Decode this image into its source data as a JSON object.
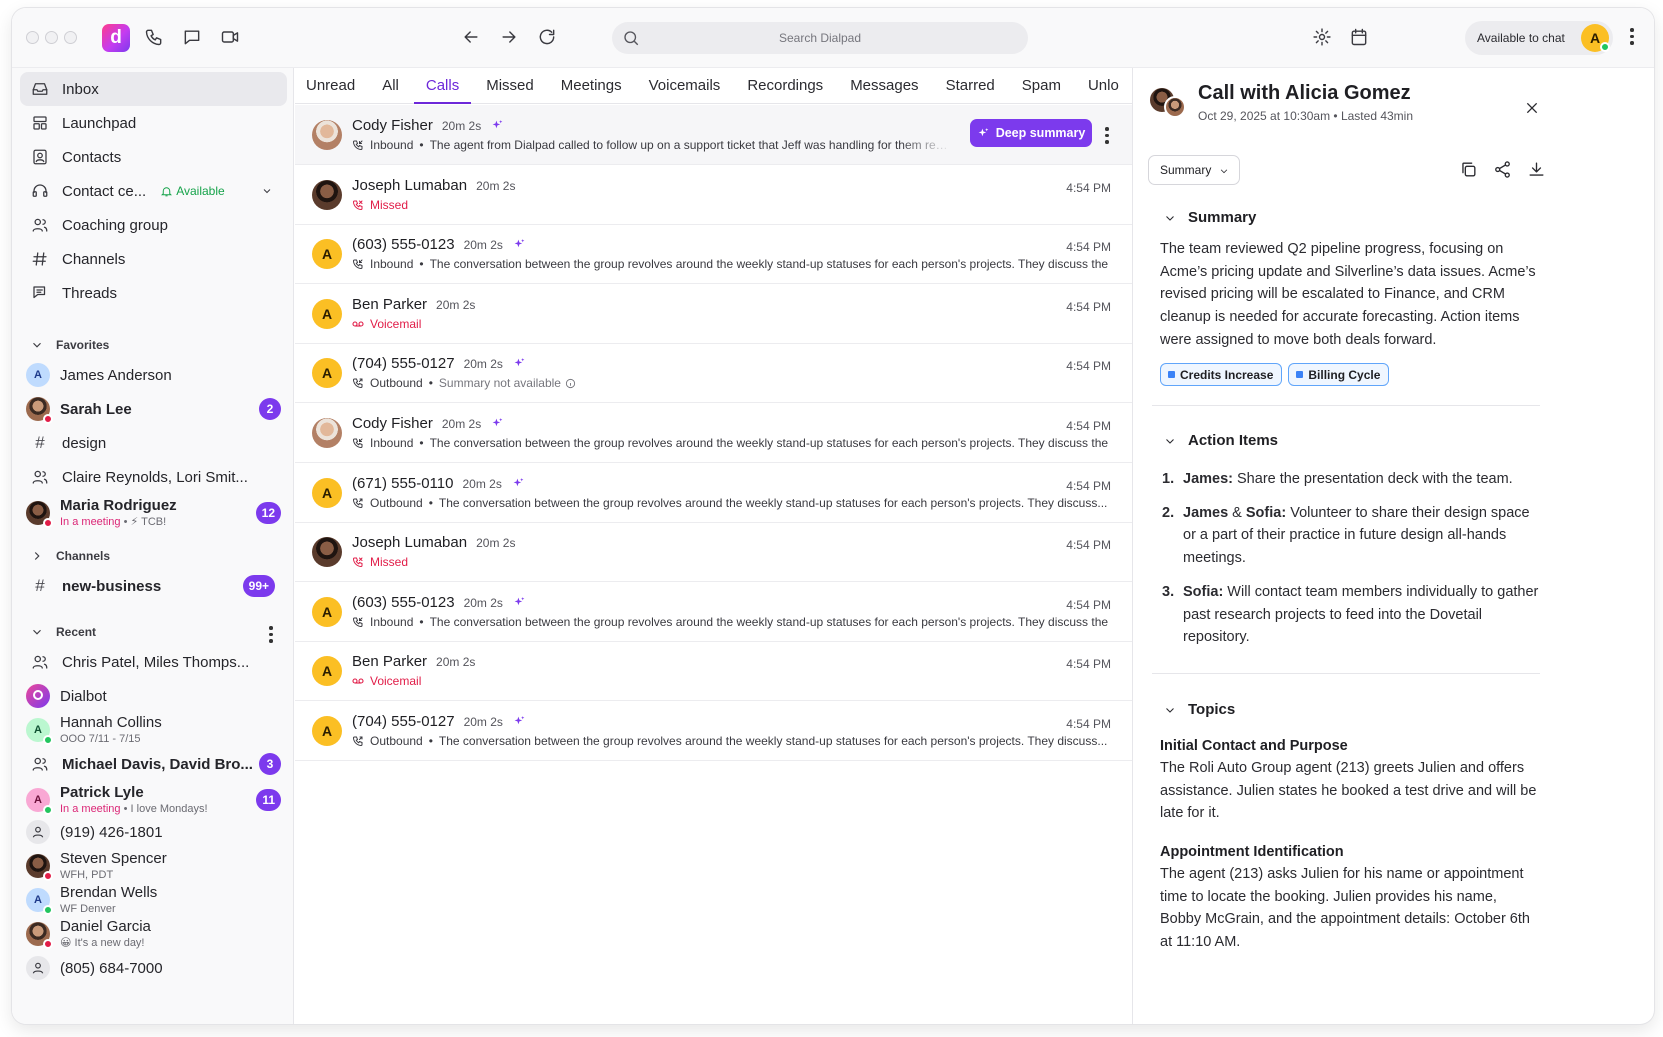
{
  "topbar": {
    "search_placeholder": "Search Dialpad",
    "status_label": "Available to chat",
    "user_initial": "A",
    "app_logo_letter": "d"
  },
  "sidebar": {
    "nav": [
      {
        "label": "Inbox",
        "icon": "inbox-icon",
        "active": true
      },
      {
        "label": "Launchpad",
        "icon": "launchpad-icon"
      },
      {
        "label": "Contacts",
        "icon": "contacts-icon"
      },
      {
        "label": "Contact ce...",
        "icon": "headset-icon",
        "status": "Available"
      },
      {
        "label": "Coaching group",
        "icon": "group-icon"
      },
      {
        "label": "Channels",
        "icon": "hash-icon"
      },
      {
        "label": "Threads",
        "icon": "threads-icon"
      }
    ],
    "favorites_heading": "Favorites",
    "favorites": {
      "james": {
        "name": "James Anderson",
        "initial": "A"
      },
      "sarah": {
        "name": "Sarah Lee",
        "badge": "2"
      },
      "design": {
        "name": "design"
      },
      "claire": {
        "name": "Claire Reynolds, Lori Smit..."
      },
      "maria": {
        "name": "Maria Rodriguez",
        "status": "In a meeting",
        "note": "⚡ TCB!",
        "badge": "12"
      }
    },
    "channels_heading": "Channels",
    "channels": {
      "new_business": {
        "name": "new-business",
        "badge": "99+"
      }
    },
    "recent_heading": "Recent",
    "recent": {
      "chris": {
        "name": "Chris Patel, Miles Thomps..."
      },
      "dialbot": {
        "name": "Dialbot"
      },
      "hannah": {
        "name": "Hannah Collins",
        "sub": "OOO 7/11 - 7/15",
        "initial": "A"
      },
      "michael": {
        "name": "Michael Davis, David Bro...",
        "badge": "3"
      },
      "patrick": {
        "name": "Patrick Lyle",
        "status": "In a meeting",
        "note": "I love Mondays!",
        "badge": "11",
        "initial": "A"
      },
      "phone1": {
        "name": "(919) 426-1801"
      },
      "steven": {
        "name": "Steven Spencer",
        "sub": "WFH, PDT"
      },
      "brendan": {
        "name": "Brendan Wells",
        "sub": "WF Denver",
        "initial": "A"
      },
      "daniel": {
        "name": "Daniel Garcia",
        "sub": "😀 It's a new day!"
      },
      "phone2": {
        "name": "(805) 684-7000"
      }
    }
  },
  "tabs": [
    "Unread",
    "All",
    "Calls",
    "Missed",
    "Meetings",
    "Voicemails",
    "Recordings",
    "Messages",
    "Starred",
    "Spam",
    "Unlo"
  ],
  "active_tab": "Calls",
  "calls": [
    {
      "name": "Cody Fisher",
      "duration": "20m 2s",
      "direction": "Inbound",
      "desc": "The agent from Dialpad called to follow up on a support ticket that Jeff was handling for them regarding",
      "deep_summary": "Deep summary"
    },
    {
      "name": "Joseph Lumaban",
      "duration": "20m 2s",
      "status": "Missed",
      "time": "4:54 PM"
    },
    {
      "name": "(603) 555-0123",
      "duration": "20m 2s",
      "direction": "Inbound",
      "desc": "The conversation between the group revolves around the weekly stand-up statuses for each person's projects. They discuss the",
      "time": "4:54 PM",
      "initial": "A"
    },
    {
      "name": "Ben Parker",
      "duration": "20m 2s",
      "status": "Voicemail",
      "time": "4:54 PM",
      "initial": "A"
    },
    {
      "name": "(704) 555-0127",
      "duration": "20m 2s",
      "direction": "Outbound",
      "desc": "Summary not available",
      "time": "4:54 PM",
      "initial": "A"
    },
    {
      "name": "Cody Fisher",
      "duration": "20m 2s",
      "direction": "Inbound",
      "desc": "The conversation between the group revolves around the weekly stand-up statuses for each person's projects. They discuss the",
      "time": "4:54 PM"
    },
    {
      "name": "(671) 555-0110",
      "duration": "20m 2s",
      "direction": "Outbound",
      "desc": "The conversation between the group revolves around the weekly stand-up statuses for each person's projects. They discuss...",
      "time": "4:54 PM",
      "initial": "A"
    },
    {
      "name": "Joseph Lumaban",
      "duration": "20m 2s",
      "status": "Missed",
      "time": "4:54 PM"
    },
    {
      "name": "(603) 555-0123",
      "duration": "20m 2s",
      "direction": "Inbound",
      "desc": "The conversation between the group revolves around the weekly stand-up statuses for each person's projects. They discuss the",
      "time": "4:54 PM",
      "initial": "A"
    },
    {
      "name": "Ben Parker",
      "duration": "20m 2s",
      "status": "Voicemail",
      "time": "4:54 PM",
      "initial": "A"
    },
    {
      "name": "(704) 555-0127",
      "duration": "20m 2s",
      "direction": "Outbound",
      "desc": "The conversation between the group revolves around the weekly stand-up statuses for each person's projects. They discuss...",
      "time": "4:54 PM",
      "initial": "A"
    }
  ],
  "panel": {
    "title": "Call with Alicia Gomez",
    "subtitle": "Oct 29, 2025 at 10:30am • Lasted 43min",
    "dropdown": "Summary",
    "summary_heading": "Summary",
    "summary_text": "The team reviewed Q2 pipeline progress, focusing on Acme’s pricing update and Silverline’s data issues. Acme’s revised pricing will be escalated to Finance, and CRM cleanup is needed for accurate forecasting. Action items were assigned to move both deals forward.",
    "chips": [
      "Credits Increase",
      "Billing Cycle"
    ],
    "action_heading": "Action Items",
    "actions": {
      "a1": {
        "num": "1.",
        "who": "James:",
        "text": " Share the presentation deck with the team."
      },
      "a2": {
        "num": "2.",
        "who": "James",
        "amp": " & ",
        "who2": "Sofia:",
        "text": " Volunteer to share their design space or a part of their practice in future design all-hands meetings."
      },
      "a3": {
        "num": "3.",
        "who": "Sofia:",
        "text": " Will contact team members individually to gather past research projects to feed into the Dovetail repository."
      }
    },
    "topics_heading": "Topics",
    "topic1_title": "Initial Contact and Purpose",
    "topic1_text": "The Roli Auto Group agent (213) greets Julien and offers assistance. Julien states he booked a test drive and will be late for it.",
    "topic2_title": "Appointment Identification",
    "topic2_text": "The agent (213) asks Julien for his name or appointment time to locate the booking. Julien provides his name, Bobby McGrain, and the appointment details: October 6th at 11:10 AM."
  },
  "colors": {
    "accent": "#7c3aed",
    "missed": "#e11d48",
    "available": "#16a34a",
    "avatar_yellow": "#fbbf24"
  }
}
